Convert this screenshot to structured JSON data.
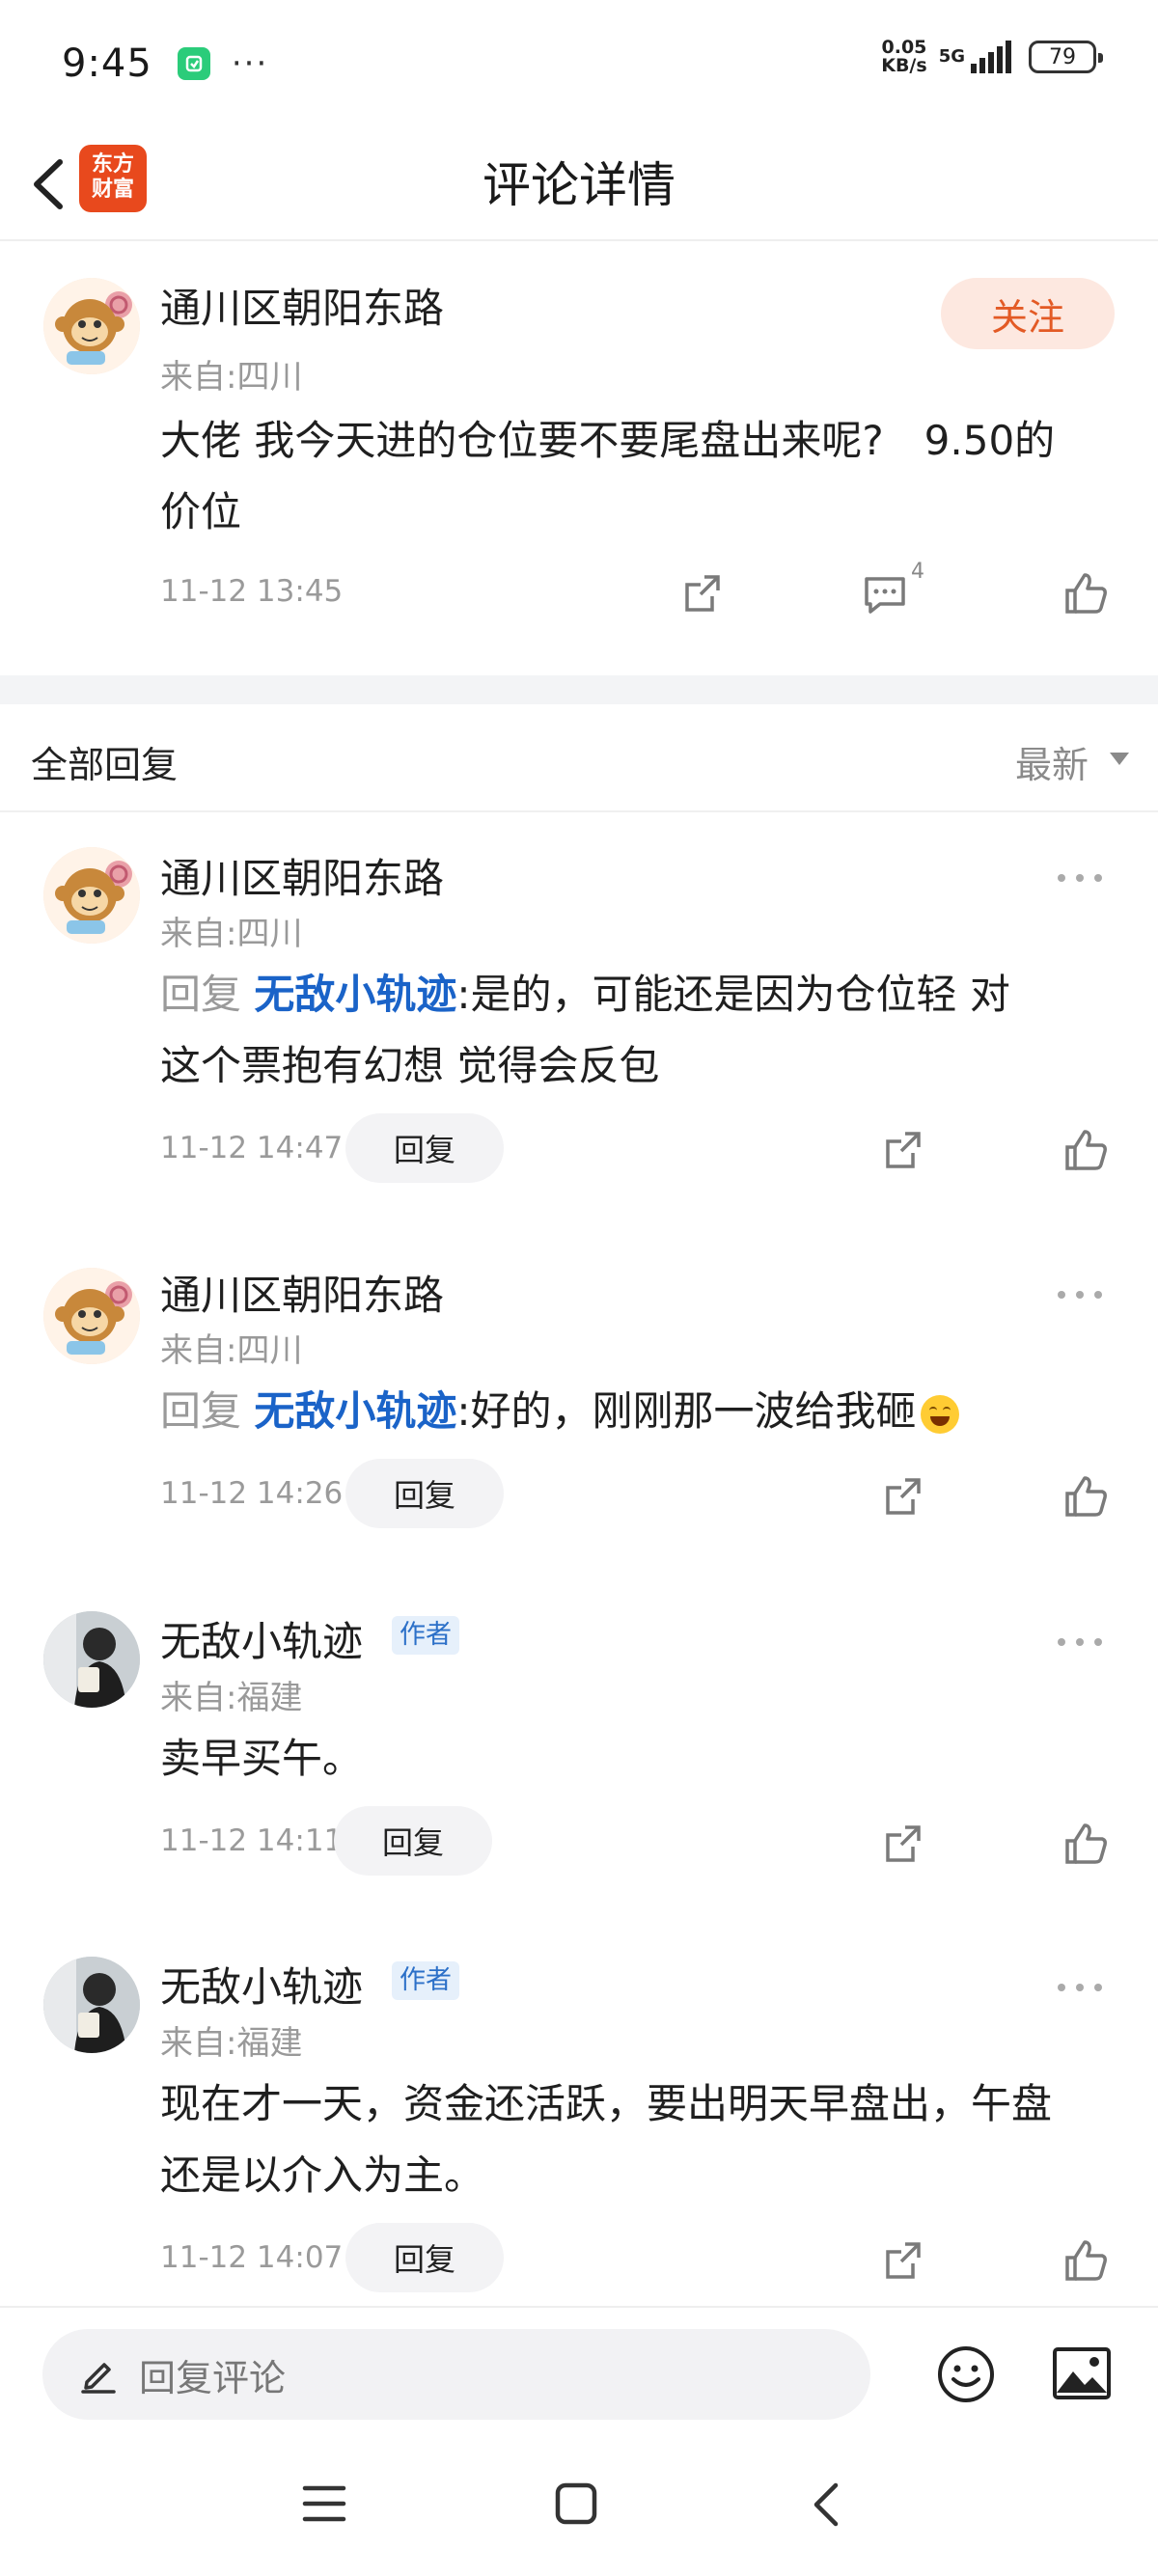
{
  "status_bar": {
    "time": "9:45",
    "dots": "···",
    "net_speed_value": "0.05",
    "net_speed_unit": "KB/s",
    "network": "5G",
    "battery": "79"
  },
  "header": {
    "title": "评论详情",
    "logo_line1": "东方",
    "logo_line2": "财富"
  },
  "main_comment": {
    "username": "通川区朝阳东路",
    "location": "来自:四川",
    "content_line1": "大佬 我今天进的仓位要不要尾盘出来呢?　9.50的",
    "content_line2": "价位",
    "time": "11-12 13:45",
    "reply_count": "4",
    "follow_label": "关注"
  },
  "replies_header": {
    "title": "全部回复",
    "sort_label": "最新"
  },
  "replies": [
    {
      "username": "通川区朝阳东路",
      "location": "来自:四川",
      "prefix": "回复",
      "target": "无敌小轨迹",
      "text_line1": ":是的，可能还是因为仓位轻  对",
      "text_line2": "这个票抱有幻想 觉得会反包",
      "time": "11-12 14:47",
      "reply_label": "回复"
    },
    {
      "username": "通川区朝阳东路",
      "location": "来自:四川",
      "prefix": "回复",
      "target": "无敌小轨迹",
      "text_line1": ":好的，刚刚那一波给我砸",
      "time": "11-12 14:26",
      "reply_label": "回复"
    },
    {
      "username": "无敌小轨迹",
      "badge": "作者",
      "location": "来自:福建",
      "text_line1": "卖早买午。",
      "time": "11-12 14:11",
      "reply_label": "回复"
    },
    {
      "username": "无敌小轨迹",
      "badge": "作者",
      "location": "来自:福建",
      "text_line1": "现在才一天，资金还活跃，要出明天早盘出，午盘",
      "text_line2": "还是以介入为主。",
      "time": "11-12 14:07",
      "reply_label": "回复"
    }
  ],
  "bottom_bar": {
    "input_placeholder": "回复评论"
  },
  "colors": {
    "brand": "#e8491d",
    "link_blue": "#1a63c8",
    "follow_bg": "#fde8e0",
    "follow_text": "#e35a25"
  },
  "icons": [
    "back-icon",
    "share-icon",
    "comment-icon",
    "like-icon",
    "more-icon",
    "edit-icon",
    "emoji-icon",
    "image-icon",
    "menu-icon",
    "home-icon",
    "nav-back-icon"
  ]
}
